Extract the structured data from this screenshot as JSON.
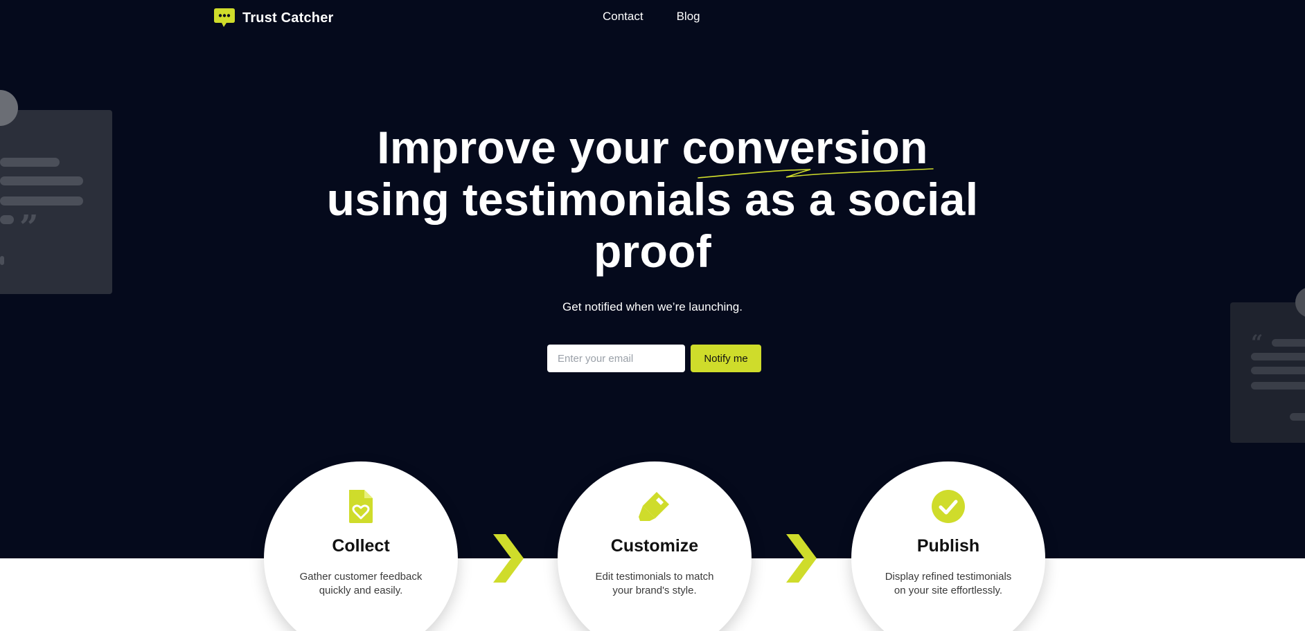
{
  "colors": {
    "background": "#050a1c",
    "accent": "#cfdc2b",
    "card_left": "#2b2f3a",
    "card_right": "#1f232e"
  },
  "header": {
    "brand": "Trust Catcher",
    "logo_icon": "chat-bubble-icon",
    "nav": [
      {
        "label": "Contact"
      },
      {
        "label": "Blog"
      }
    ]
  },
  "hero": {
    "title_part1": "Improve your ",
    "title_highlight": "conversion",
    "title_part2": "using testimonials as a social proof",
    "subtitle": "Get notified when we’re launching.",
    "email_placeholder": "Enter your email",
    "notify_label": "Notify me"
  },
  "steps": [
    {
      "icon": "heart-document-icon",
      "title": "Collect",
      "description": "Gather customer feedback quickly and easily."
    },
    {
      "icon": "highlighter-icon",
      "title": "Customize",
      "description": "Edit testimonials to match your brand's style."
    },
    {
      "icon": "check-circle-icon",
      "title": "Publish",
      "description": "Display refined testimonials on your site effortlessly."
    }
  ],
  "decor": {
    "quote_close": "”",
    "quote_open": "“"
  }
}
